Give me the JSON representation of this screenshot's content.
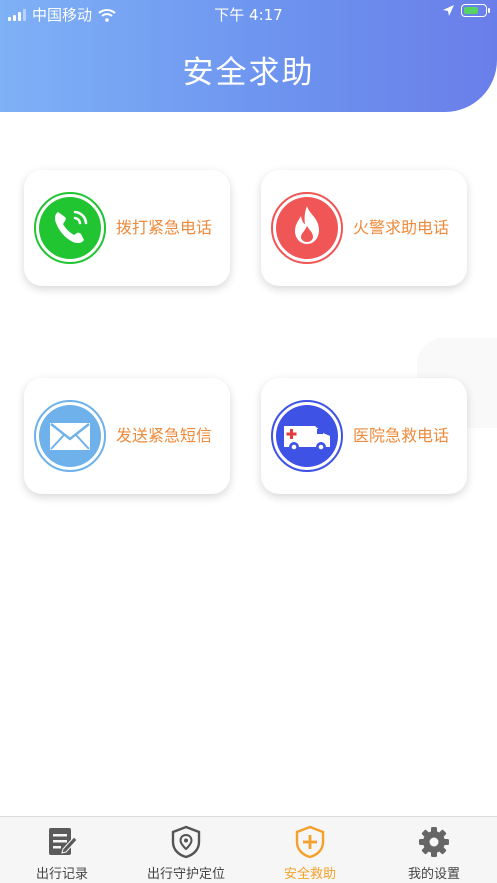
{
  "status_bar": {
    "carrier": "中国移动",
    "time": "下午 4:17"
  },
  "header": {
    "title": "安全求助"
  },
  "cards": [
    {
      "label": "拨打紧急电话",
      "icon": "phone-icon"
    },
    {
      "label": "火警求助电话",
      "icon": "fire-icon"
    },
    {
      "label": "发送紧急短信",
      "icon": "envelope-icon"
    },
    {
      "label": "医院急救电话",
      "icon": "ambulance-icon"
    }
  ],
  "tabbar": {
    "items": [
      {
        "label": "出行记录",
        "icon": "notes-icon"
      },
      {
        "label": "出行守护定位",
        "icon": "location-shield-icon"
      },
      {
        "label": "安全救助",
        "icon": "rescue-shield-icon",
        "active": true
      },
      {
        "label": "我的设置",
        "icon": "gear-icon"
      }
    ]
  },
  "colors": {
    "header_start": "#7fb1f6",
    "header_end": "#6a7ee9",
    "card_label": "#ee8a3b",
    "tab_active": "#f3a12a",
    "phone_green": "#21c431",
    "fire_red": "#f05656",
    "mail_blue": "#6fb1ea",
    "ambulance_blue": "#3f52e6"
  }
}
